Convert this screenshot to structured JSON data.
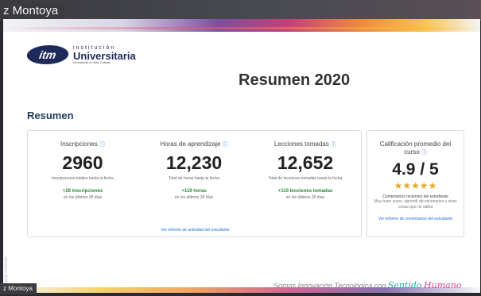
{
  "meeting": {
    "participant_name_top": "z Montoya",
    "participant_name_bottom": "z Montoya"
  },
  "slide": {
    "logo": {
      "mark": "itm",
      "line1": "institución",
      "line2": "Universitaria",
      "line3": "Acreditada en Alta Calidad"
    },
    "title": "Resumen 2020",
    "section_title": "Resumen",
    "stats": [
      {
        "label": "Inscripciones",
        "value": "2960",
        "sub": "Inscripciones totales hasta la fecha",
        "delta": "+28 inscripciones",
        "period": "en los últimos 28 días"
      },
      {
        "label": "Horas de aprendizaje",
        "value": "12,230",
        "sub": "Total de horas hasta la fecha",
        "delta": "+119 horas",
        "period": "en los últimos 28 días"
      },
      {
        "label": "Lecciones tomadas",
        "value": "12,652",
        "sub": "Total de lecciones tomadas hasta la fecha",
        "delta": "+110 lecciones tomadas",
        "period": "en los últimos 28 días"
      }
    ],
    "activity_link": "Ver informe de actividad del estudiante",
    "rating": {
      "label": "Calificación promedio del curso",
      "value": "4.9 / 5",
      "stars": "★★★★★",
      "comments_title": "Comentarios recientes del estudiante",
      "comment_text": "Muy buen curso, aprendí de escenarios y otras cosas que no sabía",
      "link": "Ver informe de comentarios del estudiante"
    },
    "tagline": {
      "prefix": "Somos Innovación Tecnológica con",
      "word1": "Sentido",
      "word2": "Humano"
    },
    "side_text": "Trabajo realizado"
  },
  "colors": {
    "accent_blue": "#2a6fd6",
    "delta_green": "#2a8a3a",
    "star_gold": "#e6a82a",
    "logo_navy": "#1e2a5a"
  }
}
